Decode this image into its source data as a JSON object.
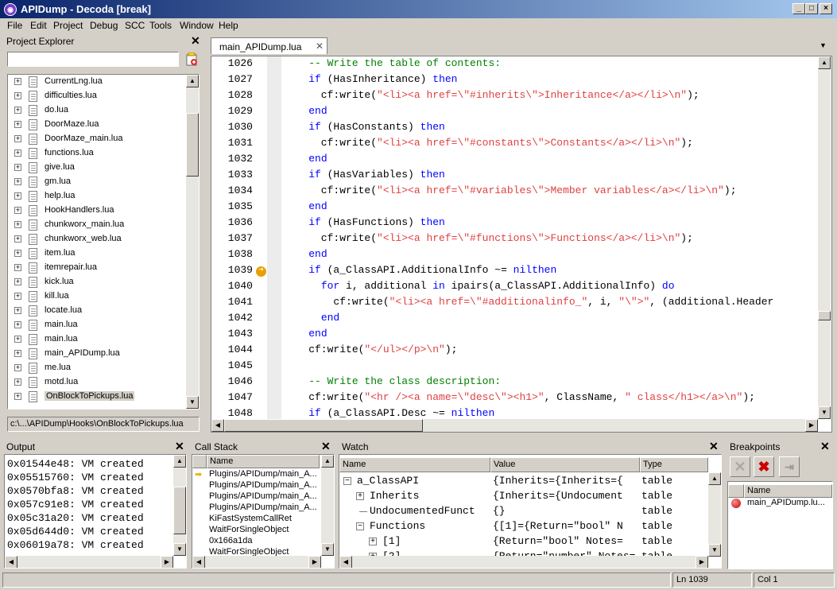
{
  "window": {
    "title": "APIDump - Decoda [break]"
  },
  "menu": [
    "File",
    "Edit",
    "Project",
    "Debug",
    "SCC",
    "Tools",
    "Window",
    "Help"
  ],
  "project_explorer": {
    "title": "Project Explorer",
    "search_value": "",
    "files": [
      "CurrentLng.lua",
      "difficulties.lua",
      "do.lua",
      "DoorMaze.lua",
      "DoorMaze_main.lua",
      "functions.lua",
      "give.lua",
      "gm.lua",
      "help.lua",
      "HookHandlers.lua",
      "chunkworx_main.lua",
      "chunkworx_web.lua",
      "item.lua",
      "itemrepair.lua",
      "kick.lua",
      "kill.lua",
      "locate.lua",
      "main.lua",
      "main.lua",
      "main_APIDump.lua",
      "me.lua",
      "motd.lua",
      "OnBlockToPickups.lua"
    ],
    "selected": "OnBlockToPickups.lua",
    "path": "c:\\...\\APIDump\\Hooks\\OnBlockToPickups.lua"
  },
  "editor": {
    "tab": "main_APIDump.lua",
    "breakpoint_line": 1039,
    "lines": [
      {
        "n": "1026",
        "t": [
          [
            "cm",
            "    -- Write the table of contents:"
          ]
        ]
      },
      {
        "n": "1027",
        "t": [
          [
            "",
            "    "
          ],
          [
            "kw",
            "if"
          ],
          [
            "",
            " (HasInheritance) "
          ],
          [
            "kw",
            "then"
          ]
        ]
      },
      {
        "n": "1028",
        "t": [
          [
            "",
            "      cf:write("
          ],
          [
            "str",
            "\"<li><a href=\\\"#inherits\\\">Inheritance</a></li>\\n\""
          ],
          [
            "",
            ");"
          ]
        ]
      },
      {
        "n": "1029",
        "t": [
          [
            "",
            "    "
          ],
          [
            "kw",
            "end"
          ]
        ]
      },
      {
        "n": "1030",
        "t": [
          [
            "",
            "    "
          ],
          [
            "kw",
            "if"
          ],
          [
            "",
            " (HasConstants) "
          ],
          [
            "kw",
            "then"
          ]
        ]
      },
      {
        "n": "1031",
        "t": [
          [
            "",
            "      cf:write("
          ],
          [
            "str",
            "\"<li><a href=\\\"#constants\\\">Constants</a></li>\\n\""
          ],
          [
            "",
            ");"
          ]
        ]
      },
      {
        "n": "1032",
        "t": [
          [
            "",
            "    "
          ],
          [
            "kw",
            "end"
          ]
        ]
      },
      {
        "n": "1033",
        "t": [
          [
            "",
            "    "
          ],
          [
            "kw",
            "if"
          ],
          [
            "",
            " (HasVariables) "
          ],
          [
            "kw",
            "then"
          ]
        ]
      },
      {
        "n": "1034",
        "t": [
          [
            "",
            "      cf:write("
          ],
          [
            "str",
            "\"<li><a href=\\\"#variables\\\">Member variables</a></li>\\n\""
          ],
          [
            "",
            ");"
          ]
        ]
      },
      {
        "n": "1035",
        "t": [
          [
            "",
            "    "
          ],
          [
            "kw",
            "end"
          ]
        ]
      },
      {
        "n": "1036",
        "t": [
          [
            "",
            "    "
          ],
          [
            "kw",
            "if"
          ],
          [
            "",
            " (HasFunctions) "
          ],
          [
            "kw",
            "then"
          ]
        ]
      },
      {
        "n": "1037",
        "t": [
          [
            "",
            "      cf:write("
          ],
          [
            "str",
            "\"<li><a href=\\\"#functions\\\">Functions</a></li>\\n\""
          ],
          [
            "",
            ");"
          ]
        ]
      },
      {
        "n": "1038",
        "t": [
          [
            "",
            "    "
          ],
          [
            "kw",
            "end"
          ]
        ]
      },
      {
        "n": "1039",
        "t": [
          [
            "",
            "    "
          ],
          [
            "kw",
            "if"
          ],
          [
            "",
            " (a_ClassAPI.AdditionalInfo ~= "
          ],
          [
            "kw",
            "nil"
          ],
          [
            ") "
          ],
          [
            "kw",
            "then"
          ]
        ]
      },
      {
        "n": "1040",
        "t": [
          [
            "",
            "      "
          ],
          [
            "kw",
            "for"
          ],
          [
            "",
            " i, additional "
          ],
          [
            "kw",
            "in"
          ],
          [
            "",
            " ipairs(a_ClassAPI.AdditionalInfo) "
          ],
          [
            "kw",
            "do"
          ]
        ]
      },
      {
        "n": "1041",
        "t": [
          [
            "",
            "        cf:write("
          ],
          [
            "str",
            "\"<li><a href=\\\"#additionalinfo_\""
          ],
          [
            "",
            ", i, "
          ],
          [
            "str",
            "\"\\\">\""
          ],
          [
            "",
            ", (additional.Header"
          ]
        ]
      },
      {
        "n": "1042",
        "t": [
          [
            "",
            "      "
          ],
          [
            "kw",
            "end"
          ]
        ]
      },
      {
        "n": "1043",
        "t": [
          [
            "",
            "    "
          ],
          [
            "kw",
            "end"
          ]
        ]
      },
      {
        "n": "1044",
        "t": [
          [
            "",
            "    cf:write("
          ],
          [
            "str",
            "\"</ul></p>\\n\""
          ],
          [
            "",
            ");"
          ]
        ]
      },
      {
        "n": "1045",
        "t": [
          [
            "",
            ""
          ]
        ]
      },
      {
        "n": "1046",
        "t": [
          [
            "cm",
            "    -- Write the class description:"
          ]
        ]
      },
      {
        "n": "1047",
        "t": [
          [
            "",
            "    cf:write("
          ],
          [
            "str",
            "\"<hr /><a name=\\\"desc\\\"><h1>\""
          ],
          [
            "",
            ", ClassName, "
          ],
          [
            "str",
            "\" class</h1></a>\\n\""
          ],
          [
            "",
            ");"
          ]
        ]
      },
      {
        "n": "1048",
        "t": [
          [
            "",
            "    "
          ],
          [
            "kw",
            "if"
          ],
          [
            "",
            " (a_ClassAPI.Desc ~= "
          ],
          [
            "kw",
            "nil"
          ],
          [
            ") "
          ],
          [
            "kw",
            "then"
          ]
        ]
      }
    ]
  },
  "output": {
    "title": "Output",
    "lines": [
      "0x01544e48: VM created",
      "0x05515760: VM created",
      "0x0570bfa8: VM created",
      "0x057c91e8: VM created",
      "0x05c31a20: VM created",
      "0x05d644d0: VM created",
      "0x06019a78: VM created"
    ]
  },
  "callstack": {
    "title": "Call Stack",
    "column": "Name",
    "rows": [
      "Plugins/APIDump/main_A...",
      "Plugins/APIDump/main_A...",
      "Plugins/APIDump/main_A...",
      "Plugins/APIDump/main_A...",
      "KiFastSystemCallRet",
      "WaitForSingleObject",
      "0x166a1da",
      "WaitForSingleObject"
    ]
  },
  "watch": {
    "title": "Watch",
    "columns": [
      "Name",
      "Value",
      "Type"
    ],
    "rows": [
      {
        "exp": "minus",
        "indent": 0,
        "name": "a_ClassAPI",
        "value": "{Inherits={Inherits={",
        "type": "table"
      },
      {
        "exp": "plus",
        "indent": 1,
        "name": "Inherits",
        "value": "{Inherits={Undocument",
        "type": "table"
      },
      {
        "exp": "line",
        "indent": 1,
        "name": "UndocumentedFunct",
        "value": "{}",
        "type": "table"
      },
      {
        "exp": "minus",
        "indent": 1,
        "name": "Functions",
        "value": "{[1]={Return=\"bool\" N",
        "type": "table"
      },
      {
        "exp": "plus",
        "indent": 2,
        "name": "[1]",
        "value": "{Return=\"bool\" Notes=",
        "type": "table"
      },
      {
        "exp": "plus",
        "indent": 2,
        "name": "[2]",
        "value": "{Return=\"number\" Notes=",
        "type": "table"
      }
    ]
  },
  "breakpoints": {
    "title": "Breakpoints",
    "column": "Name",
    "rows": [
      "main_APIDump.lu..."
    ]
  },
  "status": {
    "line": "Ln 1039",
    "col": "Col 1"
  },
  "colors": {
    "title_start": "#0a246a",
    "keyword": "#0000ff",
    "string": "#e04040",
    "comment": "#008000"
  }
}
